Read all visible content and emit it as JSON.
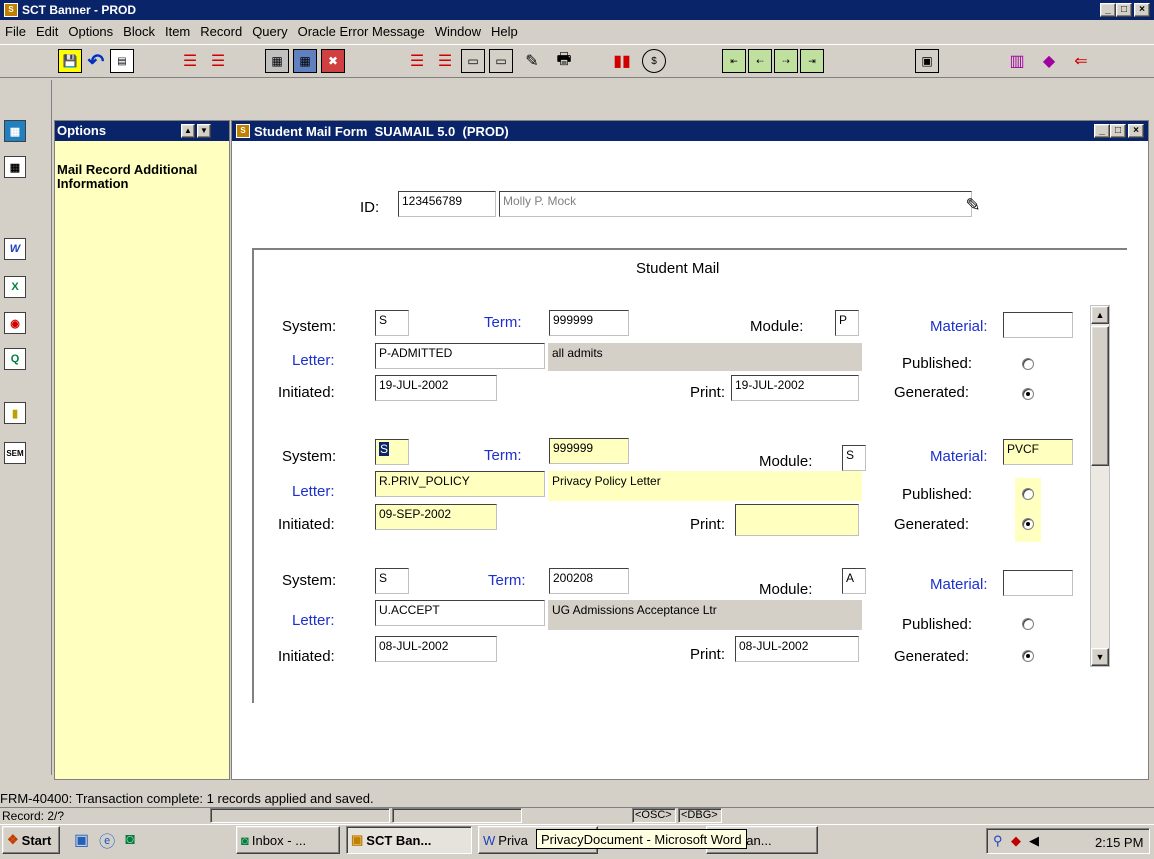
{
  "app": {
    "title": "SCT Banner - PROD"
  },
  "menu": [
    "File",
    "Edit",
    "Options",
    "Block",
    "Item",
    "Record",
    "Query",
    "Oracle Error Message",
    "Window",
    "Help"
  ],
  "options_panel": {
    "title": "Options",
    "item": "Mail Record Additional Information"
  },
  "form": {
    "title": "Student Mail Form  SUAMAIL 5.0  (PROD)",
    "id_label": "ID:",
    "id_value": "123456789",
    "name_value": "Molly P. Mock",
    "section_title": "Student Mail"
  },
  "labels": {
    "system": "System:",
    "term": "Term:",
    "module": "Module:",
    "material": "Material:",
    "letter": "Letter:",
    "published": "Published:",
    "initiated": "Initiated:",
    "print": "Print:",
    "generated": "Generated:"
  },
  "records": [
    {
      "system": "S",
      "term": "999999",
      "module": "P",
      "material": "",
      "letter": "P-ADMITTED",
      "letter_desc": "all admits",
      "initiated": "19-JUL-2002",
      "print": "19-JUL-2002",
      "published": false,
      "generated": true
    },
    {
      "system": "S",
      "term": "999999",
      "module": "S",
      "material": "PVCF",
      "letter": "R.PRIV_POLICY",
      "letter_desc": "Privacy Policy Letter",
      "initiated": "09-SEP-2002",
      "print": "",
      "published": false,
      "generated": true
    },
    {
      "system": "S",
      "term": "200208",
      "module": "A",
      "material": "",
      "letter": "U.ACCEPT",
      "letter_desc": "UG Admissions Acceptance Ltr",
      "initiated": "08-JUL-2002",
      "print": "08-JUL-2002",
      "published": false,
      "generated": true
    }
  ],
  "status": {
    "message": "FRM-40400: Transaction complete: 1 records applied and saved.",
    "record": "Record: 2/?",
    "osc": "<OSC>",
    "dbg": "<DBG>"
  },
  "taskbar": {
    "start": "Start",
    "items": [
      "Inbox - ...",
      "SCT Ban...",
      "Priva",
      "an..."
    ],
    "tooltip": "PrivacyDocument - Microsoft Word",
    "clock": "2:15 PM"
  },
  "colors": {
    "title_blue": "#0a246a",
    "options_yellow": "#ffffc0",
    "label_blue": "#1c2fcf"
  }
}
